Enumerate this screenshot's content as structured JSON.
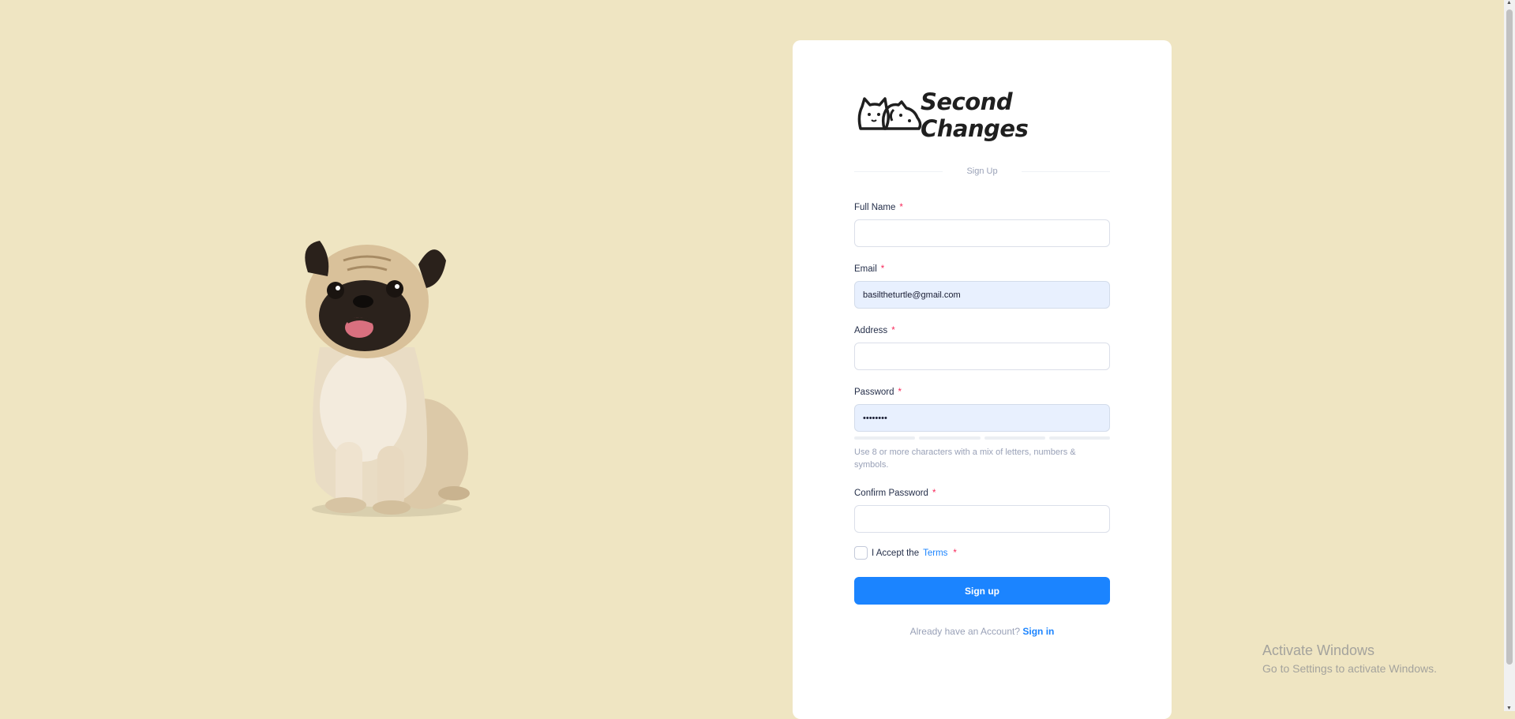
{
  "brand": {
    "name": "Second Changes",
    "logo_icon": "cat-dog-logo-icon"
  },
  "illustration": {
    "subject": "pug"
  },
  "form": {
    "title": "Sign Up",
    "full_name": {
      "label": "Full Name",
      "value": "",
      "required": "*"
    },
    "email": {
      "label": "Email",
      "value": "basiltheturtle@gmail.com",
      "required": "*"
    },
    "address": {
      "label": "Address",
      "value": "",
      "required": "*"
    },
    "password": {
      "label": "Password",
      "value": "••••••••",
      "required": "*",
      "strength_segments_filled": 0,
      "strength_segments_total": 4,
      "hint": "Use 8 or more characters with a mix of letters, numbers & symbols."
    },
    "confirm_password": {
      "label": "Confirm Password",
      "value": "",
      "required": "*"
    },
    "terms": {
      "prefix": "I Accept the",
      "link": "Terms",
      "required": "*",
      "checked": false
    },
    "submit_label": "Sign up",
    "signin": {
      "prompt": "Already have an Account?",
      "link": "Sign in"
    }
  },
  "watermark": {
    "line1": "Activate Windows",
    "line2": "Go to Settings to activate Windows."
  },
  "colors": {
    "background": "#efe5c2",
    "primary": "#1b84ff",
    "required": "#f8285a",
    "autofill": "#e8f0fe"
  }
}
